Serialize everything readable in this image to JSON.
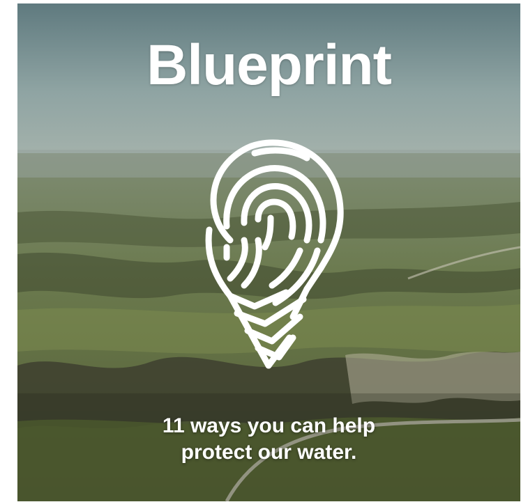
{
  "card": {
    "title": "Blueprint",
    "tagline_line1": "11 ways you can help",
    "tagline_line2": "protect our water.",
    "logo_icon": "fingerprint-location-pin-icon",
    "background": "aerial-landscape-photo",
    "text_color": "#ffffff"
  }
}
